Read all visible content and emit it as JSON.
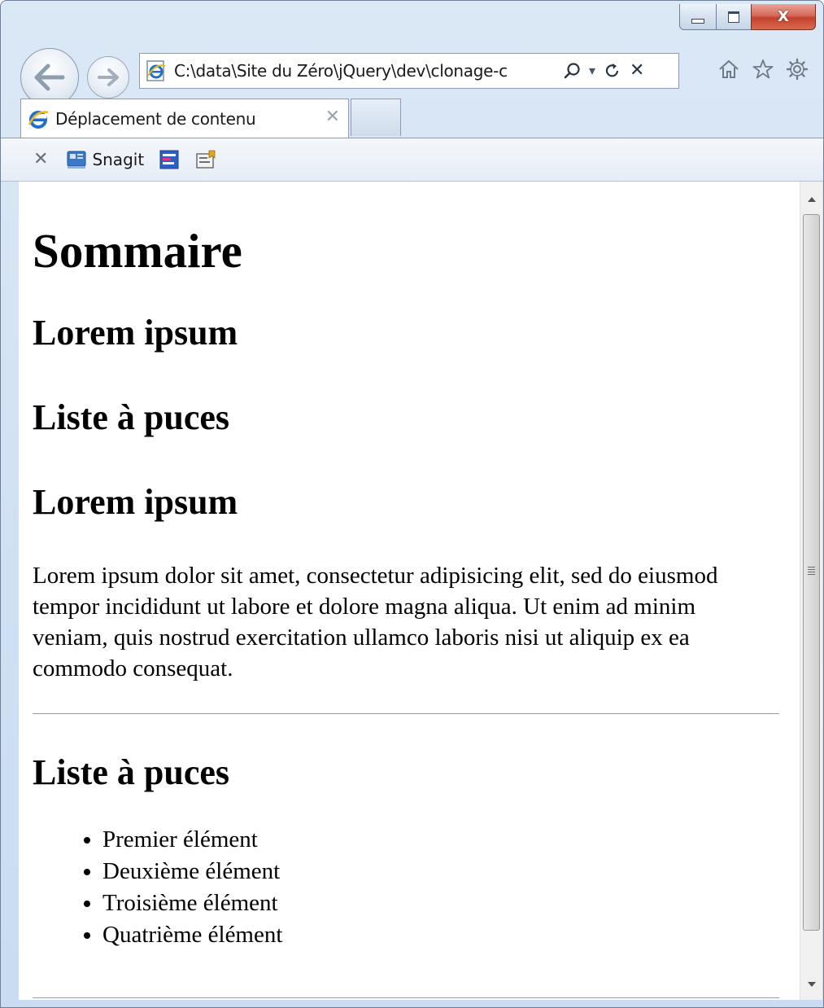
{
  "window": {
    "caption": {
      "minimize_label": "Minimize",
      "maximize_label": "Maximize",
      "close_glyph": "X"
    }
  },
  "nav": {
    "back_icon": "back-arrow-icon",
    "forward_icon": "forward-arrow-icon",
    "address": "C:\\data\\Site du Zéro\\jQuery\\dev\\clonage-c",
    "address_tools": {
      "search_icon": "search-icon",
      "dropdown_glyph": "▾",
      "refresh_icon": "refresh-icon",
      "stop_glyph": "✕"
    },
    "right_tools": [
      "home-icon",
      "favorites-star-icon",
      "settings-gear-icon"
    ]
  },
  "tabs": [
    {
      "title": "Déplacement de contenu",
      "close_glyph": "✕",
      "active": true
    }
  ],
  "toolbar": {
    "close_glyph": "✕",
    "snagit_label": "Snagit"
  },
  "page": {
    "title": "Sommaire",
    "toc": [
      "Lorem ipsum",
      "Liste à puces"
    ],
    "section1_heading": "Lorem ipsum",
    "section1_paragraph": "Lorem ipsum dolor sit amet, consectetur adipisicing elit, sed do eiusmod tempor incididunt ut labore et dolore magna aliqua. Ut enim ad minim veniam, quis nostrud exercitation ullamco laboris nisi ut aliquip ex ea commodo consequat.",
    "section2_heading": "Liste à puces",
    "list_items": [
      "Premier élément",
      "Deuxième élément",
      "Troisième élément",
      "Quatrième élément"
    ]
  },
  "colors": {
    "chrome_bg": "#cfe0f3",
    "close_button": "#c4412d",
    "ie_blue": "#1f6fc5"
  }
}
